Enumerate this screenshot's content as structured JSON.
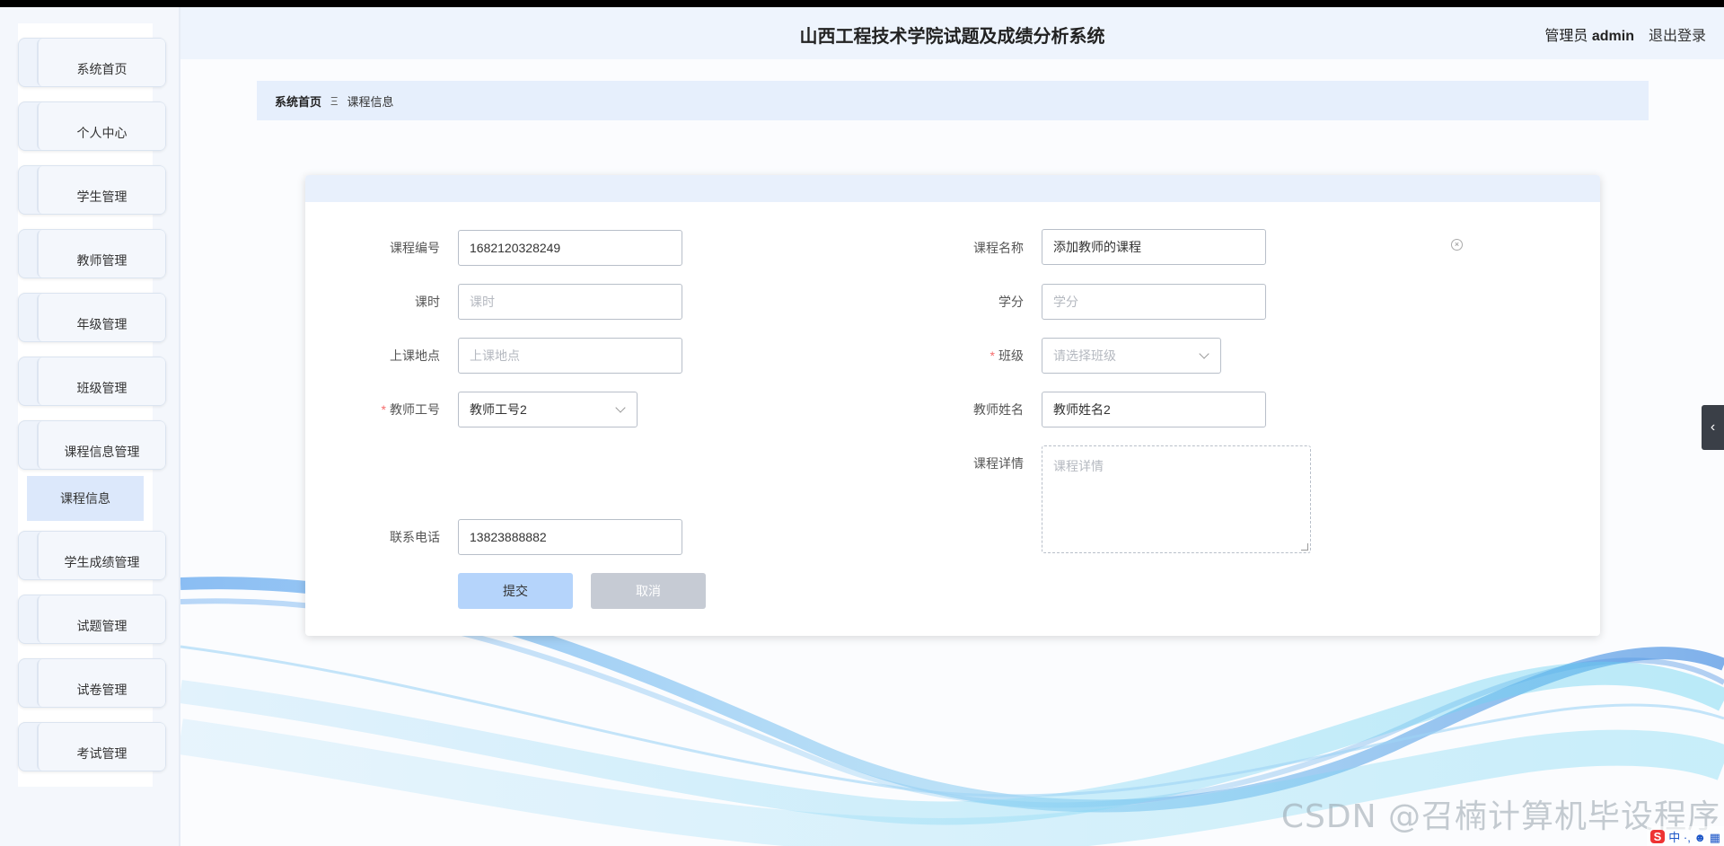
{
  "header": {
    "title": "山西工程技术学院试题及成绩分析系统",
    "role": "管理员",
    "username": "admin",
    "logout": "退出登录"
  },
  "sidebar": {
    "items": [
      {
        "label": "系统首页"
      },
      {
        "label": "个人中心"
      },
      {
        "label": "学生管理"
      },
      {
        "label": "教师管理"
      },
      {
        "label": "年级管理"
      },
      {
        "label": "班级管理"
      },
      {
        "label": "课程信息管理"
      },
      {
        "label": "学生成绩管理"
      },
      {
        "label": "试题管理"
      },
      {
        "label": "试卷管理"
      },
      {
        "label": "考试管理"
      }
    ],
    "submenu_active": "课程信息"
  },
  "breadcrumb": {
    "home": "系统首页",
    "separator": "Ξ",
    "current": "课程信息"
  },
  "form": {
    "course_no": {
      "label": "课程编号",
      "value": "1682120328249"
    },
    "course_name": {
      "label": "课程名称",
      "value": "添加教师的课程"
    },
    "hours": {
      "label": "课时",
      "placeholder": "课时"
    },
    "credit": {
      "label": "学分",
      "placeholder": "学分"
    },
    "location": {
      "label": "上课地点",
      "placeholder": "上课地点"
    },
    "class": {
      "label": "班级",
      "placeholder": "请选择班级",
      "required": "*"
    },
    "teacher_no": {
      "label": "教师工号",
      "value": "教师工号2",
      "required": "*"
    },
    "teacher_name": {
      "label": "教师姓名",
      "value": "教师姓名2"
    },
    "detail": {
      "label": "课程详情",
      "placeholder": "课程详情"
    },
    "phone": {
      "label": "联系电话",
      "value": "13823888882"
    },
    "submit": "提交",
    "cancel": "取消"
  },
  "watermark": "CSDN @召楠计算机毕设程序",
  "ime": {
    "brand": "S",
    "text": "中 ·, ☻ ▦"
  },
  "colors": {
    "accent": "#b5d4fb",
    "required": "#f56c6c",
    "header_bg": "#eef4fd"
  }
}
